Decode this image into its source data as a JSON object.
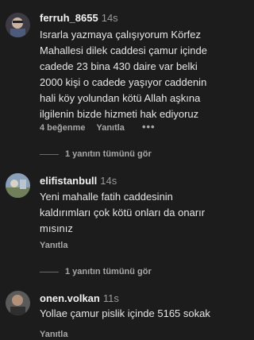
{
  "comments": [
    {
      "username": "ferruh_8655",
      "time": "14s",
      "lines": [
        "Israrla yazmaya çalışıyorum Körfez",
        "Mahallesi dilek caddesi çamur içinde",
        "cadede 23 bina 430 daire var belki",
        "2000 kişi o cadede yaşıyor caddenin",
        "hali köy yolundan kötü Allah aşkına",
        "ilgilenin bizde hizmeti hak ediyoruz"
      ],
      "likes": "4 beğenme",
      "reply": "Yanıtla",
      "more": "•••",
      "view_replies": "1 yanıtın tümünü gör"
    },
    {
      "username": "elifistanbull",
      "time": "14s",
      "lines": [
        "Yeni mahalle fatih caddesinin",
        "kaldırımları çok kötü onları da onarır",
        "mısınız"
      ],
      "reply": "Yanıtla",
      "view_replies": "1 yanıtın tümünü gör"
    },
    {
      "username": "onen.volkan",
      "time": "11s",
      "lines": [
        "Yollae çamur pislik içinde 5165 sokak"
      ],
      "reply": "Yanıtla"
    }
  ]
}
